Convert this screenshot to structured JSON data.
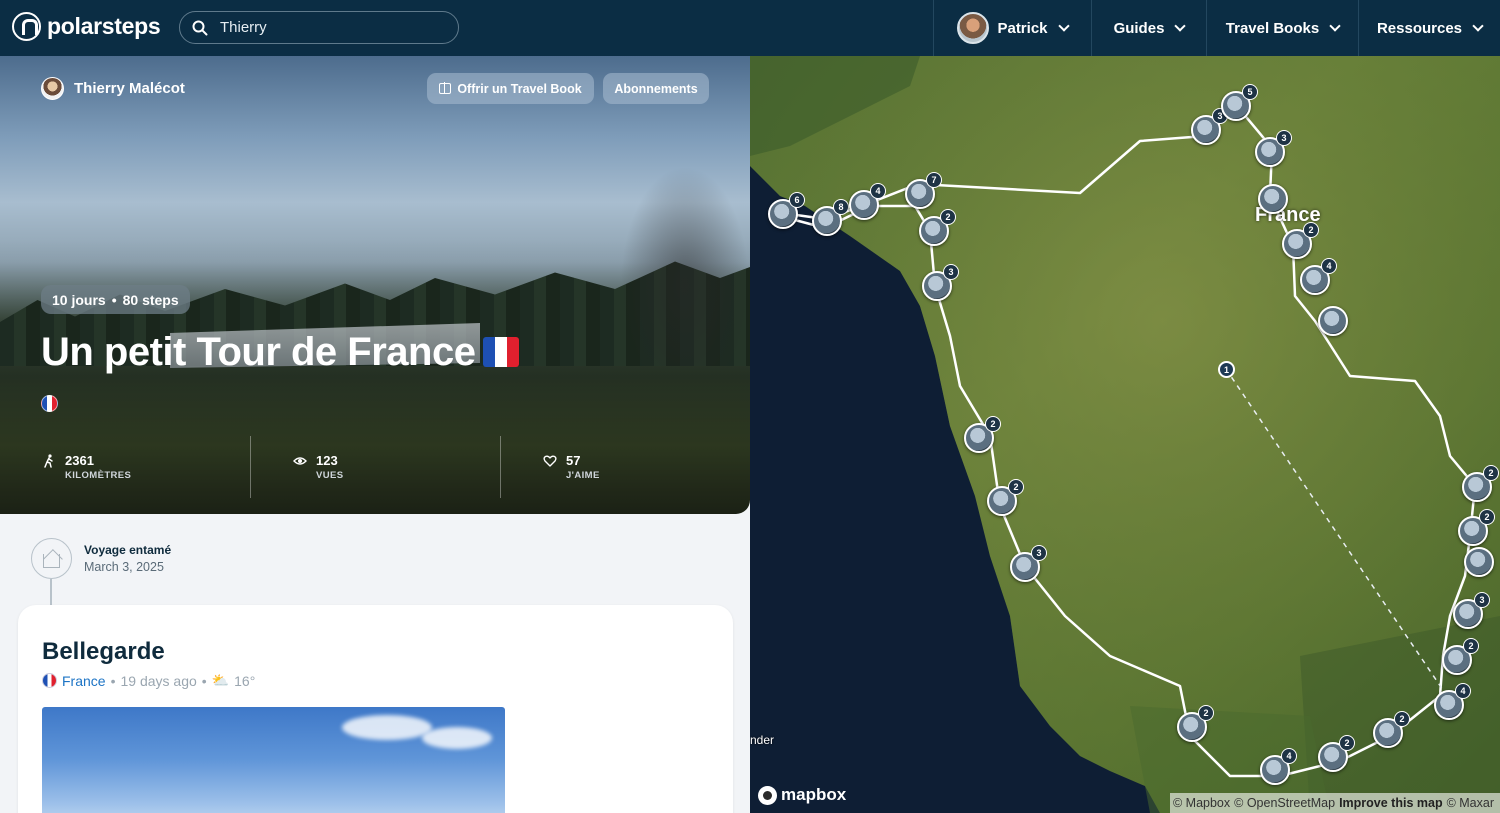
{
  "nav": {
    "brand": "polarsteps",
    "search_value": "Thierry",
    "user": "Patrick",
    "items": [
      "Guides",
      "Travel Books",
      "Ressources"
    ]
  },
  "hero": {
    "author": "Thierry Malécot",
    "gift_button": "Offrir un Travel Book",
    "subscriptions_button": "Abonnements",
    "days": "10 jours",
    "separator": "•",
    "steps": "80 steps",
    "title": "Un petit Tour de France",
    "stats": [
      {
        "icon": "walker-icon",
        "value": "2361",
        "label": "KILOMÈTRES"
      },
      {
        "icon": "eye-icon",
        "value": "123",
        "label": "VUES"
      },
      {
        "icon": "heart-icon",
        "value": "57",
        "label": "J'AIME"
      }
    ]
  },
  "timeline": {
    "started_label": "Voyage entamé",
    "started_date": "March 3, 2025"
  },
  "step": {
    "title": "Bellegarde",
    "country": "France",
    "dot": "•",
    "time": "19 days ago",
    "temperature": "16°"
  },
  "map": {
    "country_label": "France",
    "edge_label": "nder",
    "brand": "mapbox",
    "attribution": [
      "© Mapbox",
      "© OpenStreetMap",
      "Improve this map",
      "© Maxar"
    ],
    "pin_counts": [
      "6",
      "8",
      "4",
      "7",
      "2",
      "3",
      "3",
      "5",
      "3",
      "2",
      "4",
      "2",
      "2",
      "3",
      "1",
      "2",
      "2",
      "3",
      "2",
      "4",
      "2",
      "2",
      "4",
      "2"
    ]
  },
  "colors": {
    "nav_bg": "#0b2d44",
    "link_blue": "#1d74c5",
    "page_bg": "#f2f4f7"
  }
}
